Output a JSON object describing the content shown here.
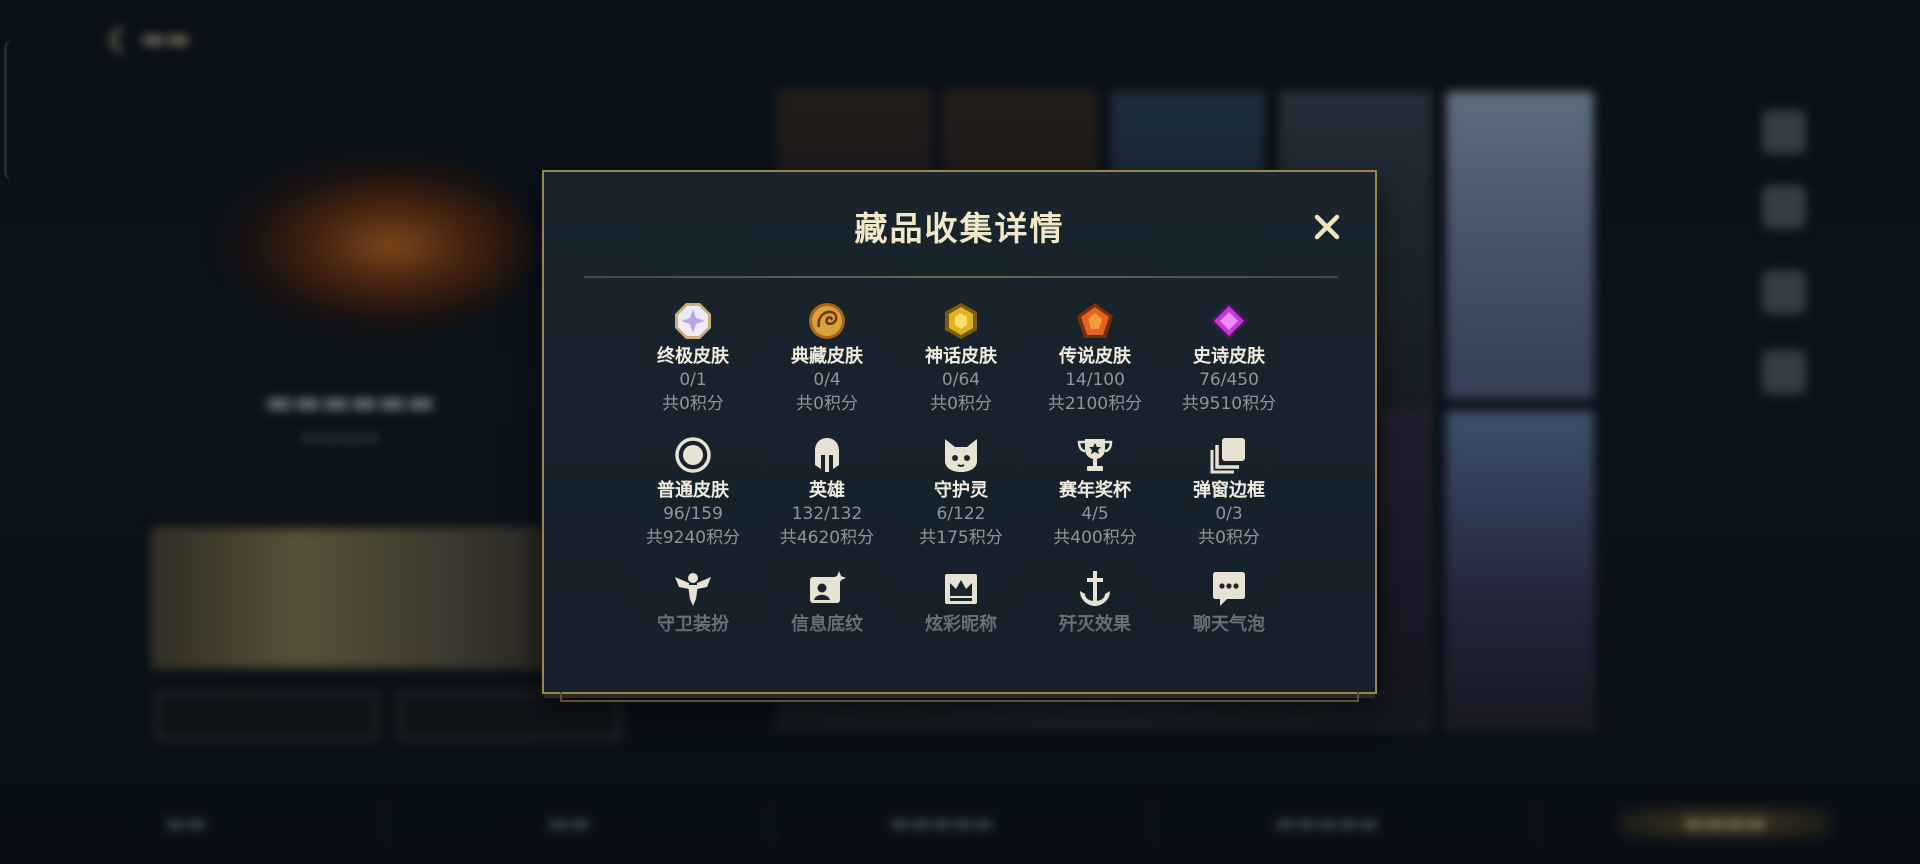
{
  "modal": {
    "title": "藏品收集详情",
    "close_label": "✕",
    "categories": [
      {
        "name": "终极皮肤",
        "count": "0/1",
        "points": "共0积分",
        "icon": "ultimate-skin-octagon-icon",
        "color": "#b8a6e8"
      },
      {
        "name": "典藏皮肤",
        "count": "0/4",
        "points": "共0积分",
        "icon": "dragon-coin-icon",
        "color": "#d9a23a"
      },
      {
        "name": "神话皮肤",
        "count": "0/64",
        "points": "共0积分",
        "icon": "gold-hexagon-gem-icon",
        "color": "#e2b21f"
      },
      {
        "name": "传说皮肤",
        "count": "14/100",
        "points": "共2100积分",
        "icon": "orange-pentagon-gem-icon",
        "color": "#e4641f"
      },
      {
        "name": "史诗皮肤",
        "count": "76/450",
        "points": "共9510积分",
        "icon": "purple-diamond-gem-icon",
        "color": "#c13ad9"
      },
      {
        "name": "普通皮肤",
        "count": "96/159",
        "points": "共9240积分",
        "icon": "ring-circle-icon",
        "color": "#e8e2d2"
      },
      {
        "name": "英雄",
        "count": "132/132",
        "points": "共4620积分",
        "icon": "spartan-helmet-icon",
        "color": "#e8e2d2"
      },
      {
        "name": "守护灵",
        "count": "6/122",
        "points": "共175积分",
        "icon": "guardian-pet-face-icon",
        "color": "#e8e2d2"
      },
      {
        "name": "赛年奖杯",
        "count": "4/5",
        "points": "共400积分",
        "icon": "trophy-icon",
        "color": "#e8e2d2"
      },
      {
        "name": "弹窗边框",
        "count": "0/3",
        "points": "共0积分",
        "icon": "stacked-frames-icon",
        "color": "#e8e2d2"
      },
      {
        "name": "守卫装扮",
        "icon": "winged-guard-icon",
        "color": "#e8e2d2"
      },
      {
        "name": "信息底纹",
        "icon": "profile-card-sparkle-icon",
        "color": "#e8e2d2"
      },
      {
        "name": "炫彩昵称",
        "icon": "crown-nameplate-icon",
        "color": "#e8e2d2"
      },
      {
        "name": "歼灭效果",
        "icon": "anchor-sword-icon",
        "color": "#e8e2d2"
      },
      {
        "name": "聊天气泡",
        "icon": "chat-bubble-icon",
        "color": "#e8e2d2"
      }
    ]
  },
  "colors": {
    "accent_gold": "#9a834f",
    "title_text": "#f1e7c9",
    "muted_text": "#8e969c"
  }
}
